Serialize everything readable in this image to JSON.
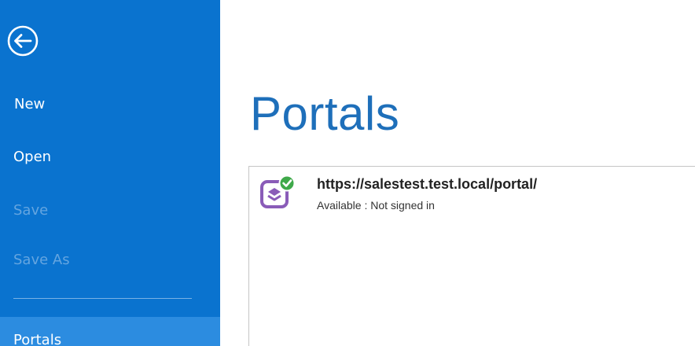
{
  "sidebar": {
    "back_icon": "back-arrow-icon",
    "items": [
      {
        "label": "New",
        "state": "enabled"
      },
      {
        "label": "Open",
        "state": "enabled"
      },
      {
        "label": "Save",
        "state": "disabled"
      },
      {
        "label": "Save As",
        "state": "disabled"
      },
      {
        "label": "Portals",
        "state": "selected"
      }
    ]
  },
  "main": {
    "title": "Portals",
    "portals": [
      {
        "url": "https://salestest.test.local/portal/",
        "status": "Available : Not signed in",
        "icon": "portal-checkmark-icon"
      }
    ]
  },
  "colors": {
    "sidebar_bg": "#0a73cf",
    "selected_item_bg": "#2c8ce0",
    "disabled_text": "#64a5e0",
    "title_text": "#1e6fba",
    "icon_purple": "#8a5cb8",
    "check_green": "#3fa94a"
  }
}
